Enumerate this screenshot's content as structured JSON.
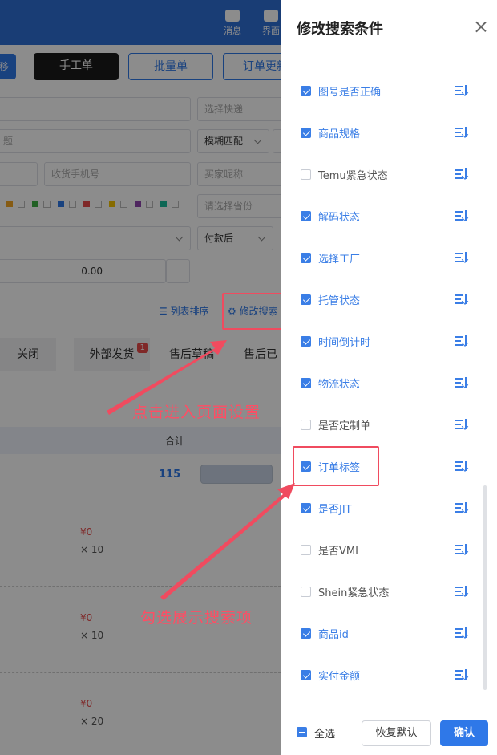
{
  "topbar": {
    "messages_label": "消息",
    "ui_label": "界面"
  },
  "toolbar": {
    "move_label": "移",
    "manual_order_label": "手工单",
    "batch_order_label": "批量单",
    "order_update_label": "订单更新"
  },
  "filters": {
    "express_placeholder": "选择快递",
    "title_placeholder": "题",
    "fuzzy_match_label": "模糊匹配",
    "phone_placeholder": "收货手机号",
    "buyer_placeholder": "买家昵称",
    "province_placeholder": "请选择省份",
    "paid_after_label": "付款后",
    "amount_value": "0.00"
  },
  "list_actions": {
    "list_sort_label": "列表排序",
    "edit_search_label": "修改搜索"
  },
  "status_tabs": [
    {
      "label": "关闭"
    },
    {
      "label": "外部发货",
      "badge": "1"
    },
    {
      "label": "售后草稿"
    },
    {
      "label": "售后已"
    }
  ],
  "table": {
    "total_header": "合计",
    "total_value": "115",
    "rows": [
      {
        "price": "¥0",
        "qty": "× 10"
      },
      {
        "price": "¥0",
        "qty": "× 10"
      },
      {
        "price": "¥0",
        "qty": "× 20"
      }
    ]
  },
  "annotations": {
    "click_hint": "点击进入页面设置",
    "check_hint": "勾选展示搜索项"
  },
  "drawer": {
    "title": "修改搜索条件",
    "items": [
      {
        "label": "图号是否正确",
        "checked": true
      },
      {
        "label": "商品规格",
        "checked": true
      },
      {
        "label": "Temu紧急状态",
        "checked": false
      },
      {
        "label": "解码状态",
        "checked": true
      },
      {
        "label": "选择工厂",
        "checked": true
      },
      {
        "label": "托管状态",
        "checked": true
      },
      {
        "label": "时间倒计时",
        "checked": true
      },
      {
        "label": "物流状态",
        "checked": true
      },
      {
        "label": "是否定制单",
        "checked": false
      },
      {
        "label": "订单标签",
        "checked": true
      },
      {
        "label": "是否JIT",
        "checked": true
      },
      {
        "label": "是否VMI",
        "checked": false
      },
      {
        "label": "Shein紧急状态",
        "checked": false
      },
      {
        "label": "商品id",
        "checked": true
      },
      {
        "label": "实付金额",
        "checked": true
      }
    ],
    "select_all_label": "全选",
    "reset_label": "恢复默认",
    "confirm_label": "确认"
  },
  "colors": {
    "accent": "#3a7ee6",
    "topbar": "#2f6fd6",
    "annotation_red": "#f04b5f"
  }
}
